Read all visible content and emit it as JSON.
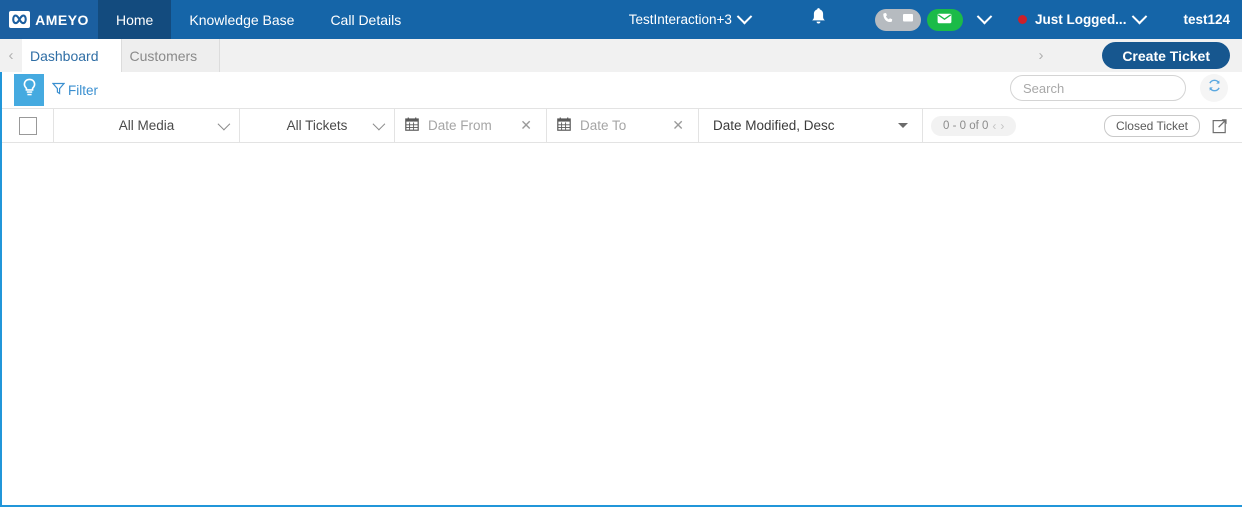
{
  "header": {
    "logo_text": "AMEYO",
    "logo_icon": "infinity-icon",
    "nav_items": [
      {
        "label": "Home",
        "active": true
      },
      {
        "label": "Knowledge Base",
        "active": false
      },
      {
        "label": "Call Details",
        "active": false
      }
    ],
    "interaction_label": "TestInteraction+3",
    "notification_icon": "bell-icon",
    "channel_icons": [
      "phone-icon",
      "chat-icon"
    ],
    "email_icon": "email-icon",
    "status_label": "Just Logged...",
    "status_color": "#cc2029",
    "user_name": "test124",
    "brand_color": "#1565a8",
    "active_nav_color": "#134b7e"
  },
  "subbar": {
    "scroll_left_icon": "chevron-left-icon",
    "scroll_right_icon": "chevron-right-icon",
    "tabs": [
      {
        "label": "Dashboard",
        "active": true
      },
      {
        "label": "Customers",
        "active": false
      }
    ],
    "create_ticket_label": "Create Ticket",
    "create_ticket_color": "#17578f"
  },
  "filterbar": {
    "bulb_icon": "lightbulb-icon",
    "bulb_bg": "#45aae0",
    "filter_icon": "funnel-icon",
    "filter_label": "Filter",
    "search_placeholder": "Search",
    "search_value": "",
    "search_icon": "search-icon",
    "refresh_icon": "refresh-icon"
  },
  "controls": {
    "select_all_checked": false,
    "media_filter": "All Media",
    "ticket_filter": "All Tickets",
    "date_from_placeholder": "Date From",
    "date_from_value": "",
    "date_to_placeholder": "Date To",
    "date_to_value": "",
    "calendar_icon": "calendar-icon",
    "clear_icon": "close-icon",
    "sort_value": "Date Modified, Desc",
    "pager_text": "0 - 0 of 0",
    "pager_prev_icon": "chevron-left-icon",
    "pager_next_icon": "chevron-right-icon",
    "closed_ticket_label": "Closed Ticket",
    "expand_icon": "external-link-icon"
  },
  "grid": {
    "rows": []
  }
}
